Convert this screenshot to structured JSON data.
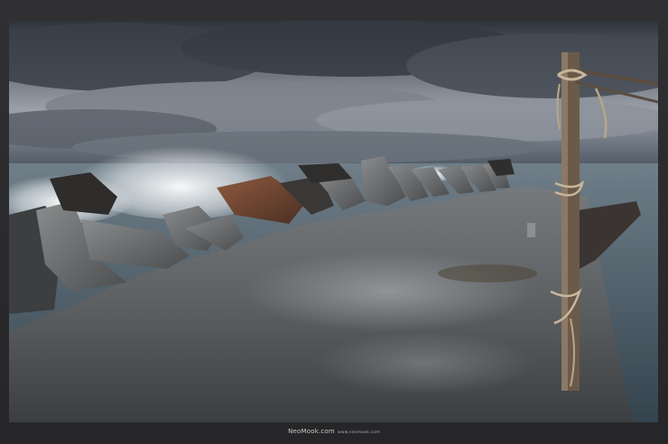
{
  "photo": {
    "subject": "concrete pier with tetrapod breakwater under stormy sky",
    "palette": {
      "sky_dark": "#2f343c",
      "sky_light": "#a9afb8",
      "sea": "#5d6d78",
      "pier": "#5c5f62",
      "rust": "#7b4a33",
      "foam": "#e9eef2"
    }
  },
  "watermark": {
    "site": "NeoMook.com",
    "url": "www.neomook.com"
  }
}
